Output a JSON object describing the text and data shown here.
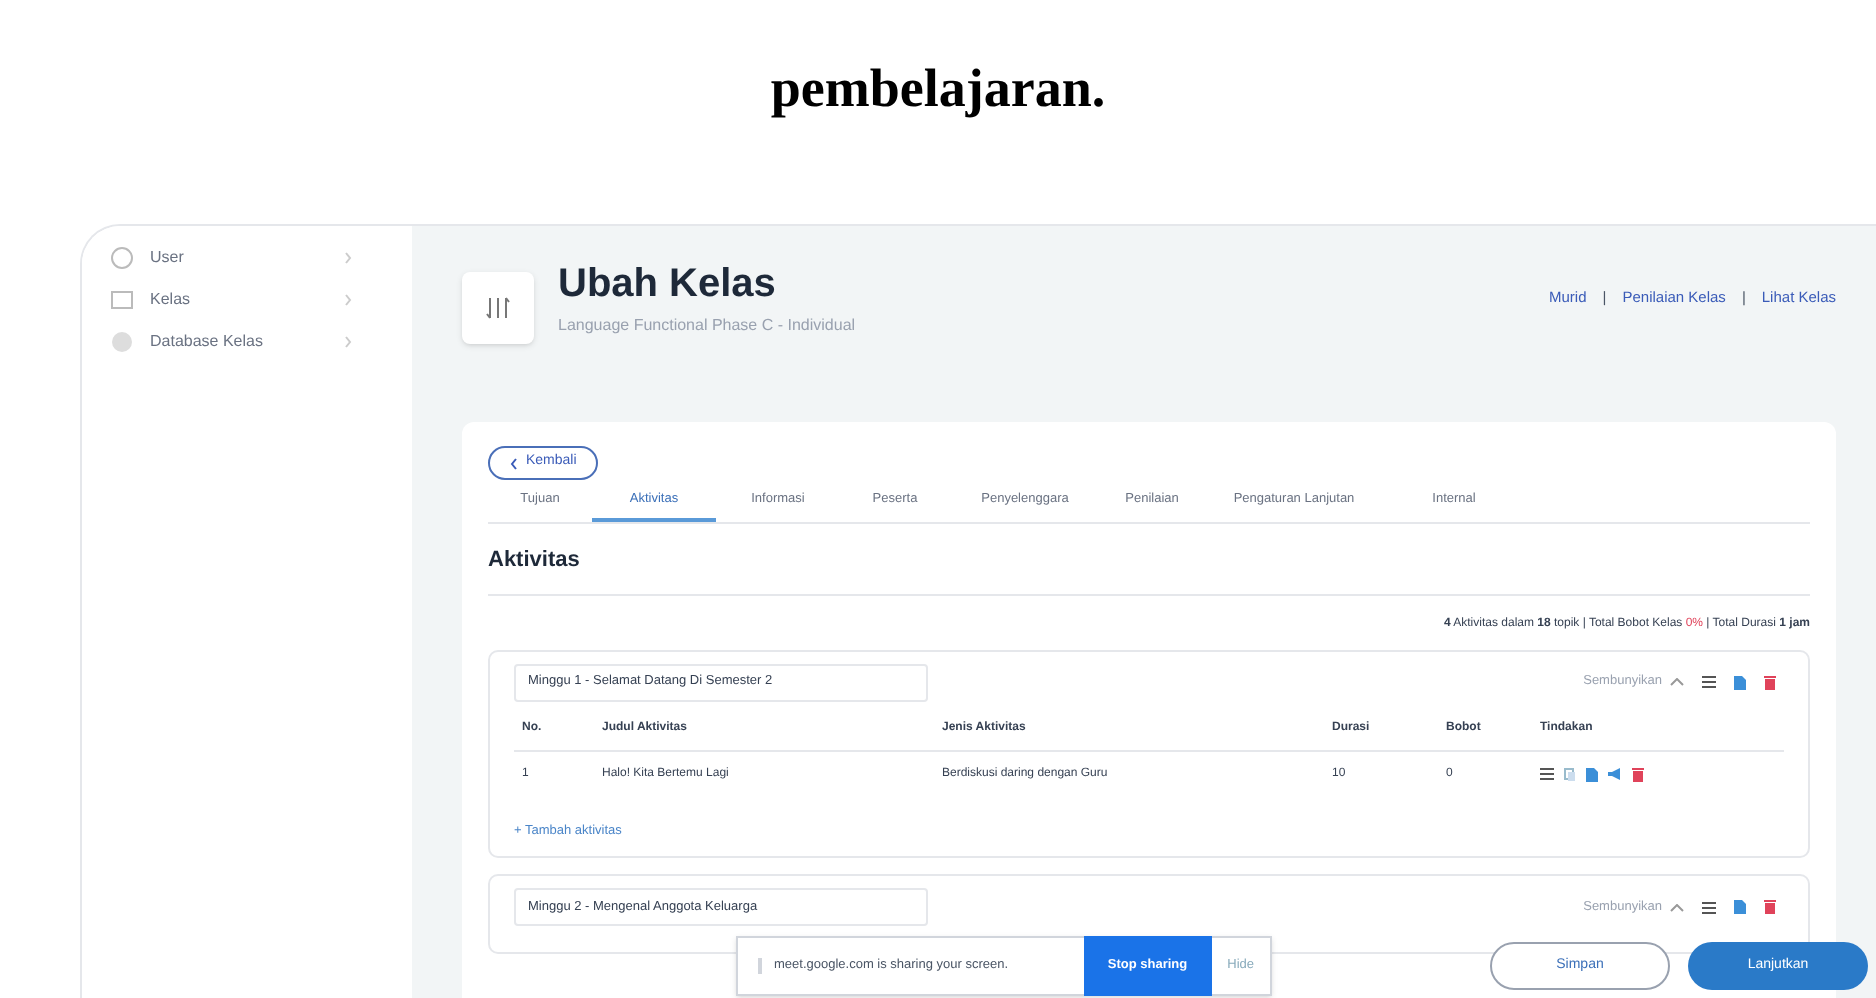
{
  "caption": "pembelajaran.",
  "sidebar": {
    "items": [
      {
        "label": "User"
      },
      {
        "label": "Kelas"
      },
      {
        "label": "Database Kelas"
      }
    ]
  },
  "header": {
    "title": "Ubah Kelas",
    "subtitle": "Language Functional Phase C - Individual",
    "links": [
      "Murid",
      "Penilaian Kelas",
      "Lihat Kelas"
    ],
    "link_separator": "|"
  },
  "back_button": "Kembali",
  "tabs": [
    {
      "label": "Tujuan",
      "selected": false
    },
    {
      "label": "Aktivitas",
      "selected": true
    },
    {
      "label": "Informasi",
      "selected": false
    },
    {
      "label": "Peserta",
      "selected": false
    },
    {
      "label": "Penyelenggara",
      "selected": false
    },
    {
      "label": "Penilaian",
      "selected": false
    },
    {
      "label": "Pengaturan Lanjutan",
      "selected": false
    },
    {
      "label": "Internal",
      "selected": false
    }
  ],
  "section_title": "Aktivitas",
  "summary": {
    "before": "**4** Aktivitas dalam **18** topik | Total Bobot Kelas ",
    "highlight": "0%",
    "after": " | Total Durasi **1 jam**"
  },
  "weeks": [
    {
      "title": "Minggu 1 - Selamat Datang Di Semester 2",
      "toggle": "Sembunyikan",
      "expanded": true,
      "columns": [
        "No.",
        "Judul Aktivitas",
        "Jenis Aktivitas",
        "Durasi",
        "Bobot",
        "Tindakan"
      ],
      "rows": [
        [
          "1",
          "Halo! Kita Bertemu Lagi",
          "Berdiskusi daring dengan Guru",
          "10",
          "0"
        ]
      ],
      "add_link": "+ Tambah aktivitas"
    },
    {
      "title": "Minggu 2 - Mengenal Anggota Keluarga",
      "toggle": "Sembunyikan",
      "expanded": true
    }
  ],
  "share_bar": {
    "message": "meet.google.com is sharing your screen.",
    "stop": "Stop sharing",
    "hide": "Hide"
  },
  "buttons": {
    "save": "Simpan",
    "next": "Lanjutkan"
  }
}
